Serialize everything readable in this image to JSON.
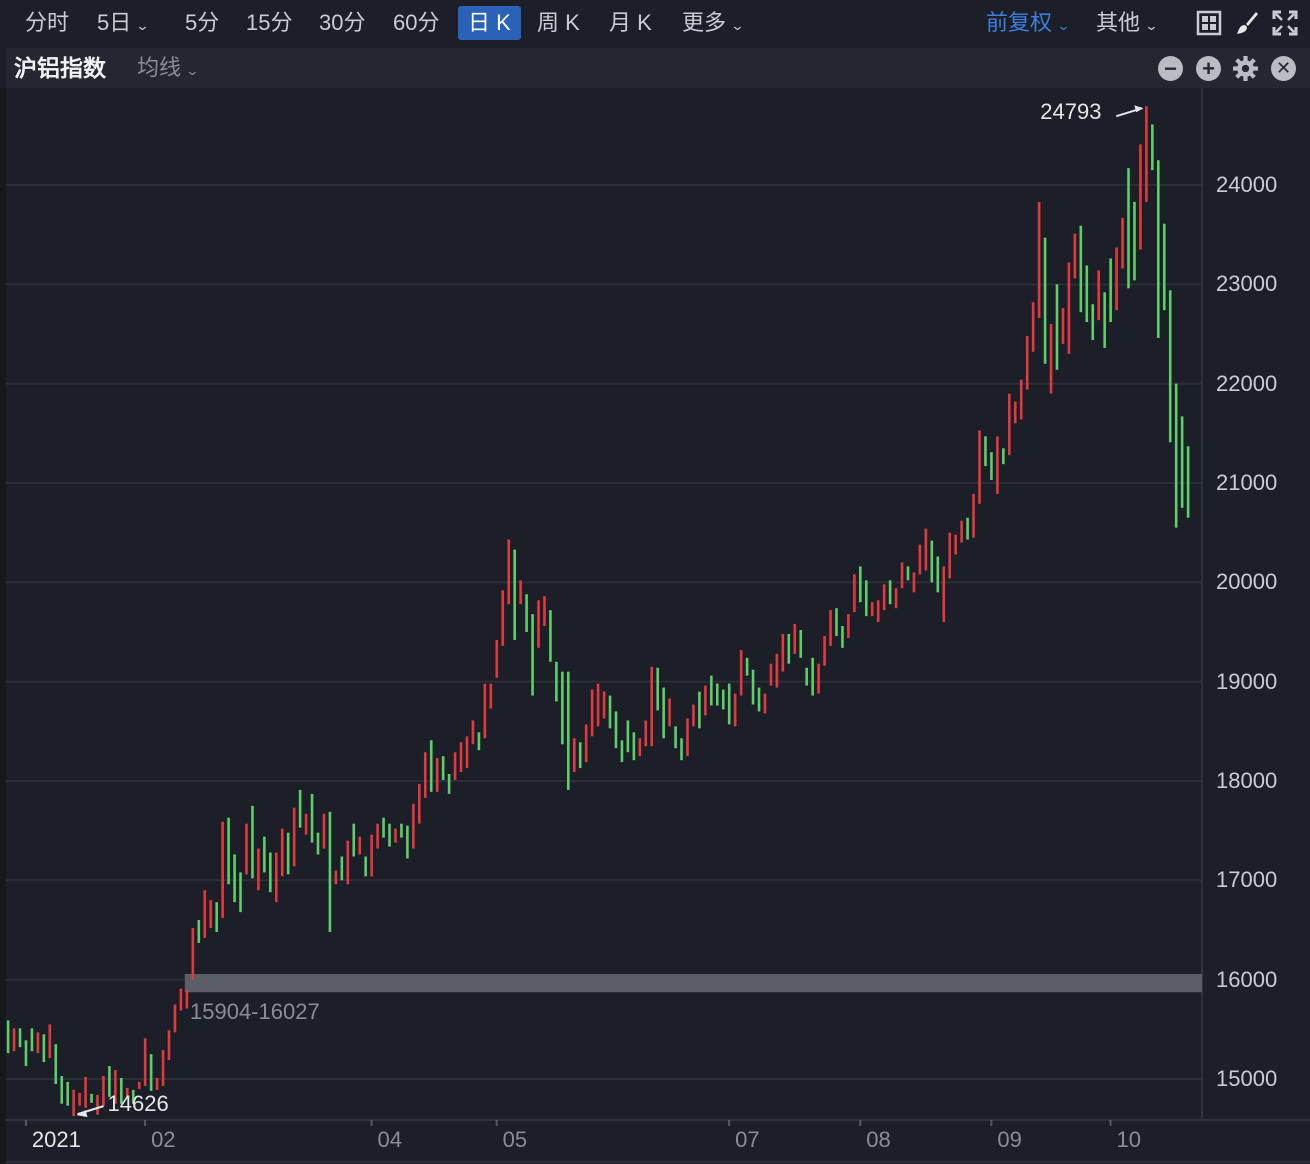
{
  "toolbar": {
    "periods": [
      "分时",
      "5日",
      "5分",
      "15分",
      "30分",
      "60分",
      "日 K",
      "周 K",
      "月 K",
      "更多"
    ],
    "active_period": "日 K",
    "adjust": "前复权",
    "other": "其他",
    "icons": [
      "grid-layout-icon",
      "brush-icon",
      "fullscreen-icon"
    ]
  },
  "subbar": {
    "instrument": "沪铝指数",
    "indicator": "均线",
    "icons": [
      "zoom-out-icon",
      "zoom-in-icon",
      "settings-icon",
      "close-icon"
    ]
  },
  "colors": {
    "up": "#e0393f",
    "down": "#5ccf6a",
    "accent": "#2a62b8",
    "band": "#5b5e67"
  },
  "chart_data": {
    "type": "candlestick",
    "title": "沪铝指数",
    "ylim": [
      14550,
      24950
    ],
    "yticks": [
      "15000",
      "16000",
      "17000",
      "18000",
      "19000",
      "20000",
      "21000",
      "22000",
      "23000",
      "24000"
    ],
    "xticks": [
      {
        "label": "2021",
        "bar_index": 3
      },
      {
        "label": "02",
        "bar_index": 23
      },
      {
        "label": "04",
        "bar_index": 61
      },
      {
        "label": "05",
        "bar_index": 82
      },
      {
        "label": "07",
        "bar_index": 121
      },
      {
        "label": "08",
        "bar_index": 143
      },
      {
        "label": "09",
        "bar_index": 165
      },
      {
        "label": "10",
        "bar_index": 185
      }
    ],
    "max_label": "24793",
    "min_label": "14626",
    "band": {
      "low": 15904,
      "high": 16027,
      "label": "15904-16027",
      "start_bar_index": 30
    },
    "bar_fields": [
      "high",
      "low",
      "up"
    ],
    "bars": [
      [
        15590,
        15260,
        0
      ],
      [
        15510,
        15280,
        1
      ],
      [
        15510,
        15320,
        0
      ],
      [
        15390,
        15130,
        0
      ],
      [
        15510,
        15280,
        0
      ],
      [
        15470,
        15260,
        1
      ],
      [
        15450,
        15170,
        0
      ],
      [
        15550,
        15210,
        1
      ],
      [
        15350,
        14950,
        0
      ],
      [
        15030,
        14750,
        0
      ],
      [
        14970,
        14730,
        0
      ],
      [
        14890,
        14626,
        1
      ],
      [
        14860,
        14730,
        1
      ],
      [
        15020,
        14710,
        1
      ],
      [
        14850,
        14760,
        0
      ],
      [
        14840,
        14640,
        1
      ],
      [
        15030,
        14730,
        1
      ],
      [
        15130,
        14820,
        0
      ],
      [
        15090,
        14750,
        1
      ],
      [
        15010,
        14750,
        0
      ],
      [
        14910,
        14810,
        1
      ],
      [
        14890,
        14750,
        0
      ],
      [
        14970,
        14900,
        1
      ],
      [
        15410,
        14930,
        1
      ],
      [
        15250,
        14880,
        0
      ],
      [
        15010,
        14890,
        1
      ],
      [
        15290,
        14930,
        1
      ],
      [
        15490,
        15190,
        1
      ],
      [
        15750,
        15470,
        1
      ],
      [
        15910,
        15690,
        1
      ],
      [
        15890,
        15710,
        1
      ],
      [
        16520,
        16000,
        1
      ],
      [
        16600,
        16370,
        0
      ],
      [
        16900,
        16420,
        1
      ],
      [
        16800,
        16520,
        1
      ],
      [
        16780,
        16480,
        0
      ],
      [
        17590,
        16620,
        1
      ],
      [
        17630,
        16960,
        0
      ],
      [
        17260,
        16780,
        0
      ],
      [
        17080,
        16680,
        0
      ],
      [
        17570,
        17060,
        1
      ],
      [
        17750,
        17020,
        0
      ],
      [
        17320,
        16900,
        1
      ],
      [
        17440,
        17080,
        0
      ],
      [
        17280,
        16880,
        0
      ],
      [
        17280,
        16780,
        1
      ],
      [
        17520,
        17040,
        1
      ],
      [
        17480,
        17060,
        0
      ],
      [
        17730,
        17140,
        1
      ],
      [
        17910,
        17530,
        0
      ],
      [
        17670,
        17460,
        1
      ],
      [
        17870,
        17380,
        0
      ],
      [
        17480,
        17260,
        0
      ],
      [
        17670,
        17320,
        1
      ],
      [
        17690,
        16480,
        0
      ],
      [
        17100,
        16960,
        1
      ],
      [
        17240,
        17000,
        0
      ],
      [
        17400,
        16960,
        1
      ],
      [
        17570,
        17240,
        0
      ],
      [
        17440,
        17260,
        1
      ],
      [
        17240,
        17040,
        0
      ],
      [
        17460,
        17040,
        1
      ],
      [
        17570,
        17320,
        1
      ],
      [
        17630,
        17430,
        0
      ],
      [
        17570,
        17340,
        0
      ],
      [
        17520,
        17380,
        1
      ],
      [
        17570,
        17430,
        0
      ],
      [
        17550,
        17220,
        0
      ],
      [
        17770,
        17320,
        1
      ],
      [
        17970,
        17570,
        1
      ],
      [
        18290,
        17830,
        1
      ],
      [
        18410,
        17890,
        0
      ],
      [
        18230,
        17890,
        1
      ],
      [
        18250,
        18010,
        0
      ],
      [
        18070,
        17870,
        0
      ],
      [
        18290,
        18010,
        1
      ],
      [
        18390,
        18090,
        1
      ],
      [
        18450,
        18130,
        1
      ],
      [
        18610,
        18370,
        1
      ],
      [
        18490,
        18310,
        0
      ],
      [
        18980,
        18430,
        1
      ],
      [
        18980,
        18730,
        1
      ],
      [
        19420,
        19040,
        1
      ],
      [
        19920,
        19360,
        1
      ],
      [
        20430,
        19780,
        1
      ],
      [
        20330,
        19420,
        0
      ],
      [
        20020,
        19780,
        1
      ],
      [
        19880,
        19500,
        0
      ],
      [
        19680,
        18860,
        0
      ],
      [
        19820,
        19340,
        1
      ],
      [
        19860,
        19560,
        1
      ],
      [
        19720,
        19200,
        0
      ],
      [
        19200,
        18800,
        0
      ],
      [
        19100,
        18370,
        0
      ],
      [
        19100,
        17910,
        0
      ],
      [
        18430,
        18090,
        1
      ],
      [
        18390,
        18130,
        0
      ],
      [
        18570,
        18190,
        1
      ],
      [
        18920,
        18450,
        1
      ],
      [
        18980,
        18550,
        1
      ],
      [
        18900,
        18630,
        1
      ],
      [
        18860,
        18530,
        0
      ],
      [
        18700,
        18330,
        0
      ],
      [
        18410,
        18190,
        0
      ],
      [
        18610,
        18290,
        0
      ],
      [
        18490,
        18210,
        0
      ],
      [
        18430,
        18250,
        1
      ],
      [
        18610,
        18350,
        1
      ],
      [
        19150,
        18350,
        1
      ],
      [
        19140,
        18710,
        0
      ],
      [
        18940,
        18430,
        0
      ],
      [
        18830,
        18550,
        1
      ],
      [
        18550,
        18330,
        0
      ],
      [
        18430,
        18210,
        0
      ],
      [
        18630,
        18250,
        1
      ],
      [
        18770,
        18550,
        1
      ],
      [
        18900,
        18530,
        0
      ],
      [
        18960,
        18660,
        1
      ],
      [
        19060,
        18760,
        0
      ],
      [
        18980,
        18760,
        0
      ],
      [
        18920,
        18720,
        0
      ],
      [
        18980,
        18570,
        0
      ],
      [
        18880,
        18550,
        1
      ],
      [
        19320,
        18860,
        1
      ],
      [
        19240,
        19060,
        0
      ],
      [
        19120,
        18770,
        0
      ],
      [
        18940,
        18700,
        0
      ],
      [
        18880,
        18680,
        1
      ],
      [
        19180,
        18960,
        1
      ],
      [
        19280,
        18940,
        1
      ],
      [
        19480,
        19100,
        1
      ],
      [
        19480,
        19180,
        0
      ],
      [
        19580,
        19280,
        1
      ],
      [
        19520,
        19240,
        0
      ],
      [
        19140,
        18960,
        0
      ],
      [
        19240,
        18860,
        0
      ],
      [
        19180,
        18880,
        1
      ],
      [
        19460,
        19160,
        1
      ],
      [
        19720,
        19360,
        1
      ],
      [
        19740,
        19460,
        0
      ],
      [
        19560,
        19340,
        0
      ],
      [
        19680,
        19440,
        1
      ],
      [
        20080,
        19700,
        1
      ],
      [
        20160,
        19800,
        0
      ],
      [
        20020,
        19660,
        0
      ],
      [
        19800,
        19660,
        1
      ],
      [
        19820,
        19600,
        1
      ],
      [
        19980,
        19720,
        1
      ],
      [
        20020,
        19780,
        0
      ],
      [
        19940,
        19740,
        1
      ],
      [
        20200,
        19940,
        1
      ],
      [
        20160,
        20020,
        0
      ],
      [
        20100,
        19900,
        1
      ],
      [
        20380,
        20080,
        1
      ],
      [
        20540,
        20120,
        1
      ],
      [
        20420,
        20000,
        0
      ],
      [
        20260,
        19900,
        0
      ],
      [
        20160,
        19600,
        1
      ],
      [
        20500,
        20040,
        1
      ],
      [
        20480,
        20280,
        1
      ],
      [
        20620,
        20400,
        1
      ],
      [
        20650,
        20430,
        0
      ],
      [
        20890,
        20450,
        1
      ],
      [
        21530,
        20790,
        1
      ],
      [
        21470,
        21170,
        0
      ],
      [
        21310,
        21030,
        0
      ],
      [
        21470,
        20890,
        1
      ],
      [
        21350,
        21190,
        0
      ],
      [
        21900,
        21280,
        1
      ],
      [
        21820,
        21600,
        1
      ],
      [
        22040,
        21640,
        1
      ],
      [
        22480,
        21940,
        1
      ],
      [
        22820,
        22320,
        1
      ],
      [
        23830,
        22660,
        1
      ],
      [
        23470,
        22200,
        0
      ],
      [
        22600,
        21900,
        1
      ],
      [
        23000,
        22140,
        0
      ],
      [
        22760,
        22400,
        1
      ],
      [
        23220,
        22300,
        1
      ],
      [
        23510,
        23060,
        1
      ],
      [
        23590,
        22720,
        0
      ],
      [
        23190,
        22620,
        0
      ],
      [
        22800,
        22440,
        0
      ],
      [
        23140,
        22640,
        1
      ],
      [
        22920,
        22360,
        0
      ],
      [
        23260,
        22620,
        0
      ],
      [
        23370,
        22740,
        1
      ],
      [
        23670,
        23160,
        1
      ],
      [
        24170,
        22960,
        0
      ],
      [
        23830,
        23040,
        0
      ],
      [
        24410,
        23350,
        1
      ],
      [
        24793,
        23830,
        1
      ],
      [
        24610,
        24150,
        0
      ],
      [
        24250,
        22460,
        0
      ],
      [
        23610,
        22740,
        0
      ],
      [
        22940,
        21410,
        0
      ],
      [
        22000,
        20550,
        0
      ],
      [
        21670,
        20750,
        0
      ],
      [
        21370,
        20650,
        0
      ]
    ]
  }
}
